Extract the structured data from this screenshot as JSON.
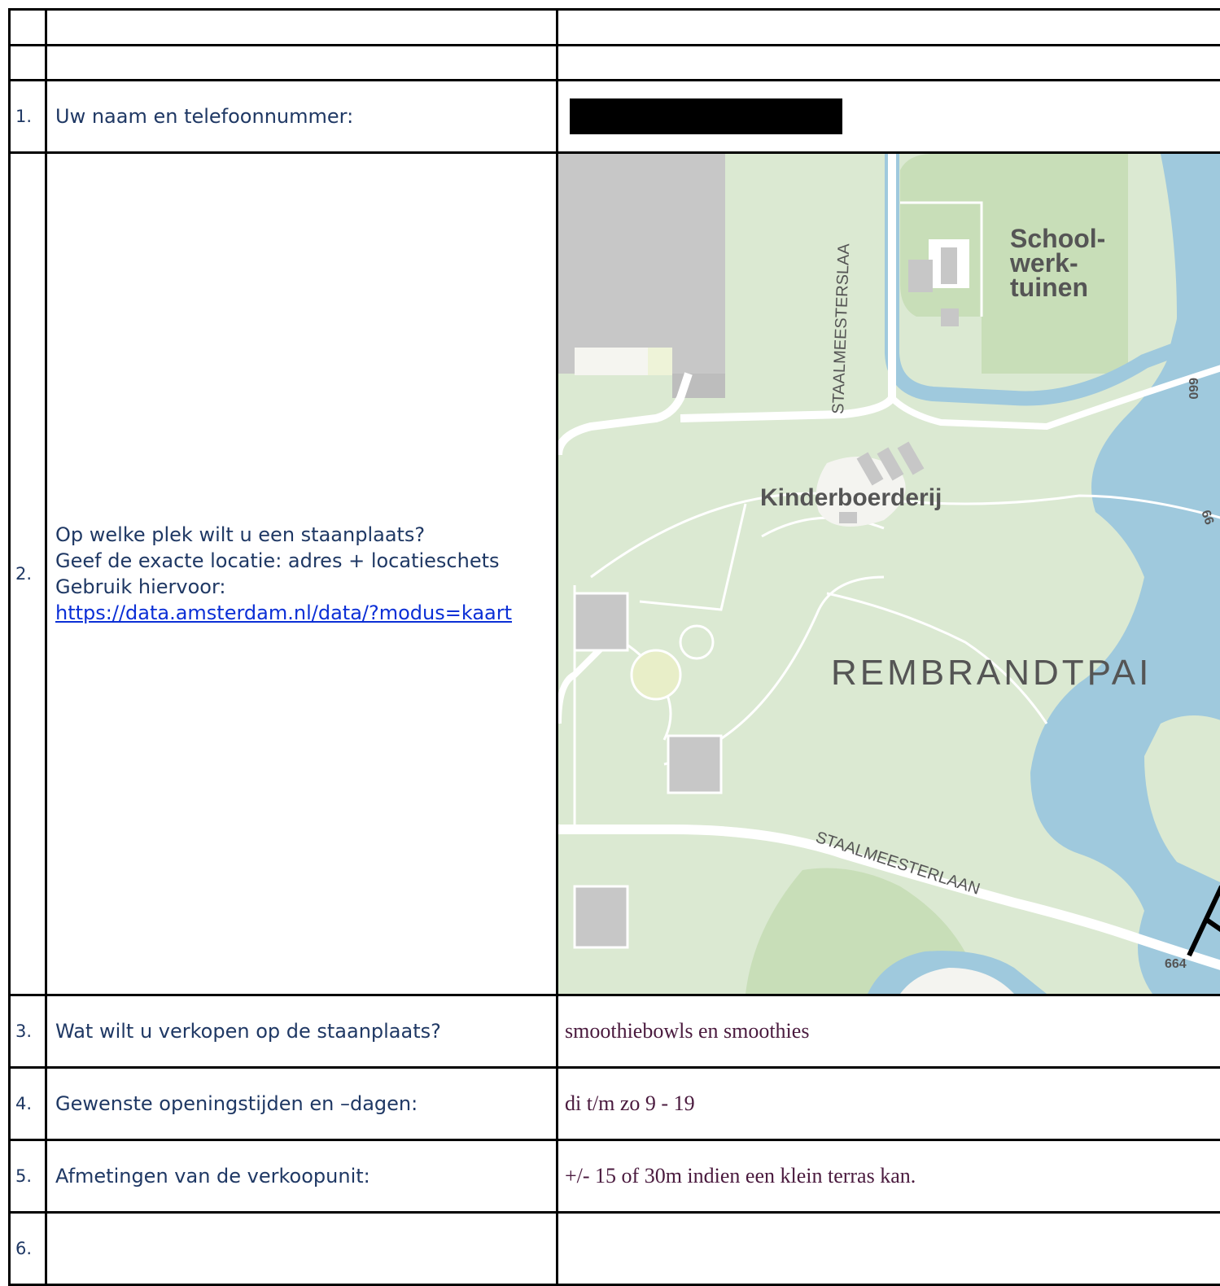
{
  "rows": [
    {
      "num": "",
      "question": "",
      "answer": ""
    },
    {
      "num": "",
      "question": "",
      "answer": ""
    },
    {
      "num": "1.",
      "question": "Uw naam en telefoonnummer:",
      "answer": "[redacted]"
    },
    {
      "num": "2.",
      "question_lines": [
        "Op welke plek wilt u een staanplaats?",
        "Geef de exacte locatie: adres + locatieschets",
        "Gebruik hiervoor:"
      ],
      "link": "https://data.amsterdam.nl/data/?modus=kaart"
    },
    {
      "num": "3.",
      "question": "Wat wilt u verkopen op de staanplaats?",
      "answer": "smoothiebowls en smoothies"
    },
    {
      "num": "4.",
      "question": "Gewenste openingstijden en –dagen:",
      "answer": "di t/m zo 9 - 19"
    },
    {
      "num": "5.",
      "question": "Afmetingen van de verkoopunit:",
      "answer": "+/- 15 of 30m indien een klein terras kan."
    },
    {
      "num": "6.",
      "question": "",
      "answer": ""
    }
  ],
  "map": {
    "labels": {
      "school": [
        "School-",
        "werk-",
        "tuinen"
      ],
      "kinderboerderij": "Kinderboerderij",
      "park": "REMBRANDTPAI",
      "street_vertical": "STAALMEESTERSLAA",
      "street_curved": "STAALMEESTERLAAN",
      "road_num_top": "660",
      "road_num_mid": "66",
      "road_num_bottom": "664"
    },
    "colors": {
      "land": "#dbe9d2",
      "park": "#c8deb8",
      "water": "#9fc9dd",
      "building": "#c7c7c7",
      "path": "#ffffff"
    }
  }
}
